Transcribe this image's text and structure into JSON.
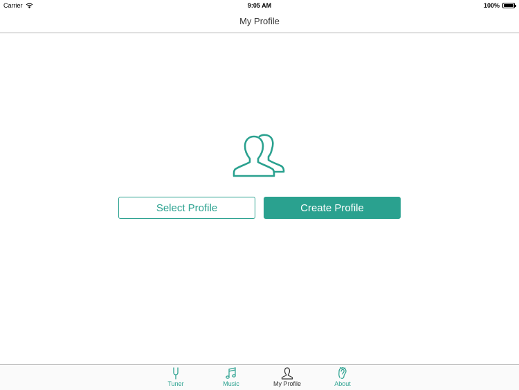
{
  "status_bar": {
    "carrier": "Carrier",
    "time": "9:05 AM",
    "battery": "100%",
    "battery_level": 1.0
  },
  "nav": {
    "title": "My Profile"
  },
  "main": {
    "icon": "users-icon",
    "select_label": "Select Profile",
    "create_label": "Create Profile"
  },
  "tabs": [
    {
      "label": "Tuner",
      "icon": "tuning-fork-icon",
      "active": false
    },
    {
      "label": "Music",
      "icon": "music-note-icon",
      "active": false
    },
    {
      "label": "My Profile",
      "icon": "person-icon",
      "active": true
    },
    {
      "label": "About",
      "icon": "ear-icon",
      "active": false
    }
  ],
  "colors": {
    "accent": "#2aa18f",
    "text": "#333333",
    "divider": "#b2b2b2"
  }
}
